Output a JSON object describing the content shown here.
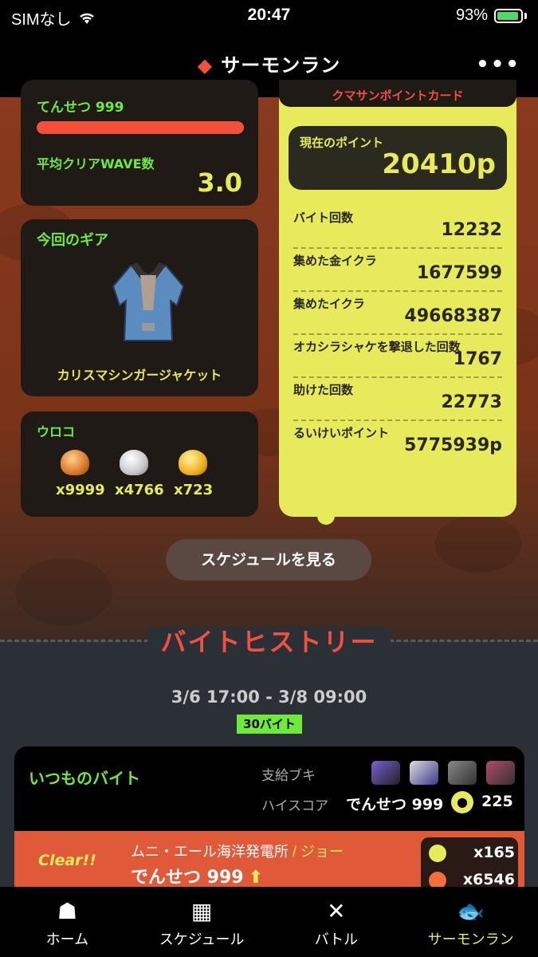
{
  "status": {
    "carrier": "SIMなし",
    "time": "20:47",
    "battery": "93%"
  },
  "nav": {
    "title": "サーモンラン",
    "more": "•••"
  },
  "rank": {
    "title": "てんせつ 999",
    "avg_label": "平均クリアWAVE数",
    "avg_value": "3.0",
    "progress": 1.0
  },
  "gear": {
    "label": "今回のギア",
    "name": "カリスマシンガージャケット"
  },
  "scales": {
    "label": "ウロコ",
    "items": [
      {
        "count": "x9999",
        "color": "#d9782a"
      },
      {
        "count": "x4766",
        "color": "#c8c8c8"
      },
      {
        "count": "x723",
        "color": "#f0b020"
      }
    ]
  },
  "pointcard": {
    "title": "クマサンポイントカード",
    "current_label": "現在のポイント",
    "current_value": "20410p",
    "rows": [
      {
        "label": "バイト回数",
        "value": "12232"
      },
      {
        "label": "集めた金イクラ",
        "value": "1677599"
      },
      {
        "label": "集めたイクラ",
        "value": "49668387"
      },
      {
        "label": "オカシラシャケを撃退した回数",
        "value": "1767"
      },
      {
        "label": "助けた回数",
        "value": "22773"
      },
      {
        "label": "るいけいポイント",
        "value": "5775939p"
      }
    ]
  },
  "schedule_button": "スケジュールを見る",
  "history": {
    "title": "バイトヒストリー",
    "period": "3/6 17:00 - 3/8 09:00",
    "badge": "30バイト",
    "job": {
      "title": "いつものバイト",
      "supply_label": "支給ブキ",
      "highscore_label": "ハイスコア",
      "highscore_name": "でんせつ 999",
      "highscore_value": "225",
      "weapons": [
        "#7a5fd0",
        "#3a3a8a",
        "#888888",
        "#b04a6a"
      ],
      "result": {
        "clear": "Clear!!",
        "stage": "ムニ・エール海洋発電所",
        "separator": " / ",
        "boss": "ジョー",
        "player": "でんせつ 999",
        "up": "⬆",
        "golden": "x165",
        "eggs": "x6546"
      }
    }
  },
  "tabs": [
    {
      "label": "ホーム",
      "icon": "squid-icon",
      "glyph": "☗"
    },
    {
      "label": "スケジュール",
      "icon": "calendar-icon",
      "glyph": "▦"
    },
    {
      "label": "バトル",
      "icon": "battle-icon",
      "glyph": "✕"
    },
    {
      "label": "サーモンラン",
      "icon": "salmon-icon",
      "glyph": "🐟"
    }
  ]
}
